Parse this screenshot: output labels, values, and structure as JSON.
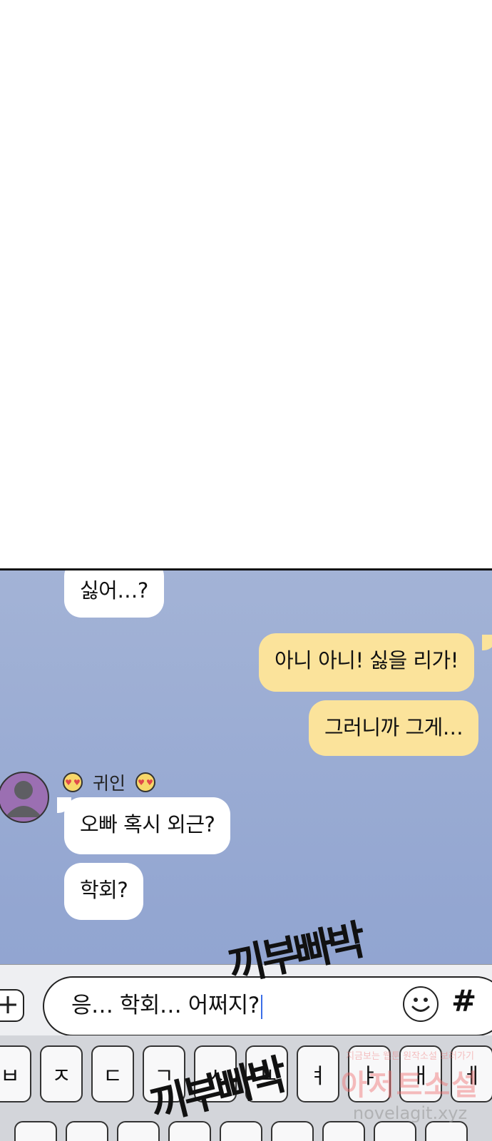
{
  "chat": {
    "messages": [
      {
        "id": "m1",
        "side": "in",
        "text": "싫어…?"
      },
      {
        "id": "m2",
        "side": "out",
        "text": "아니 아니! 싫을 리가!"
      },
      {
        "id": "m3",
        "side": "out",
        "text": "그러니까 그게…"
      },
      {
        "id": "m4",
        "side": "in",
        "text": "오빠 혹시 외근?"
      },
      {
        "id": "m5",
        "side": "in",
        "text": "학회?"
      }
    ],
    "sender_name": "귀인"
  },
  "input": {
    "value": "응… 학회… 어쩌지?",
    "plus_icon": "+",
    "hash_icon": "#"
  },
  "keyboard": {
    "keys": [
      "ㅂ",
      "ㅈ",
      "ㄷ",
      "ㄱ",
      "ㅅ",
      "ㅛ",
      "ㅕ",
      "ㅑ",
      "ㅐ",
      "ㅔ"
    ]
  },
  "sfx": {
    "text": "끼부빠박"
  },
  "watermark": {
    "line1": "지금보는 웹툰 원작소설 보러가기",
    "line2": "아저트소설",
    "url": "novelagit.xyz"
  },
  "colors": {
    "chat_bg": "#9aabd4",
    "incoming_bubble": "#ffffff",
    "outgoing_bubble": "#fbe39b",
    "avatar": "#9b6fb2",
    "caret": "#3a6ee8"
  },
  "icons": [
    "plus-icon",
    "smiley-icon",
    "hashtag-icon",
    "heart-eyes-icon",
    "avatar-icon"
  ]
}
